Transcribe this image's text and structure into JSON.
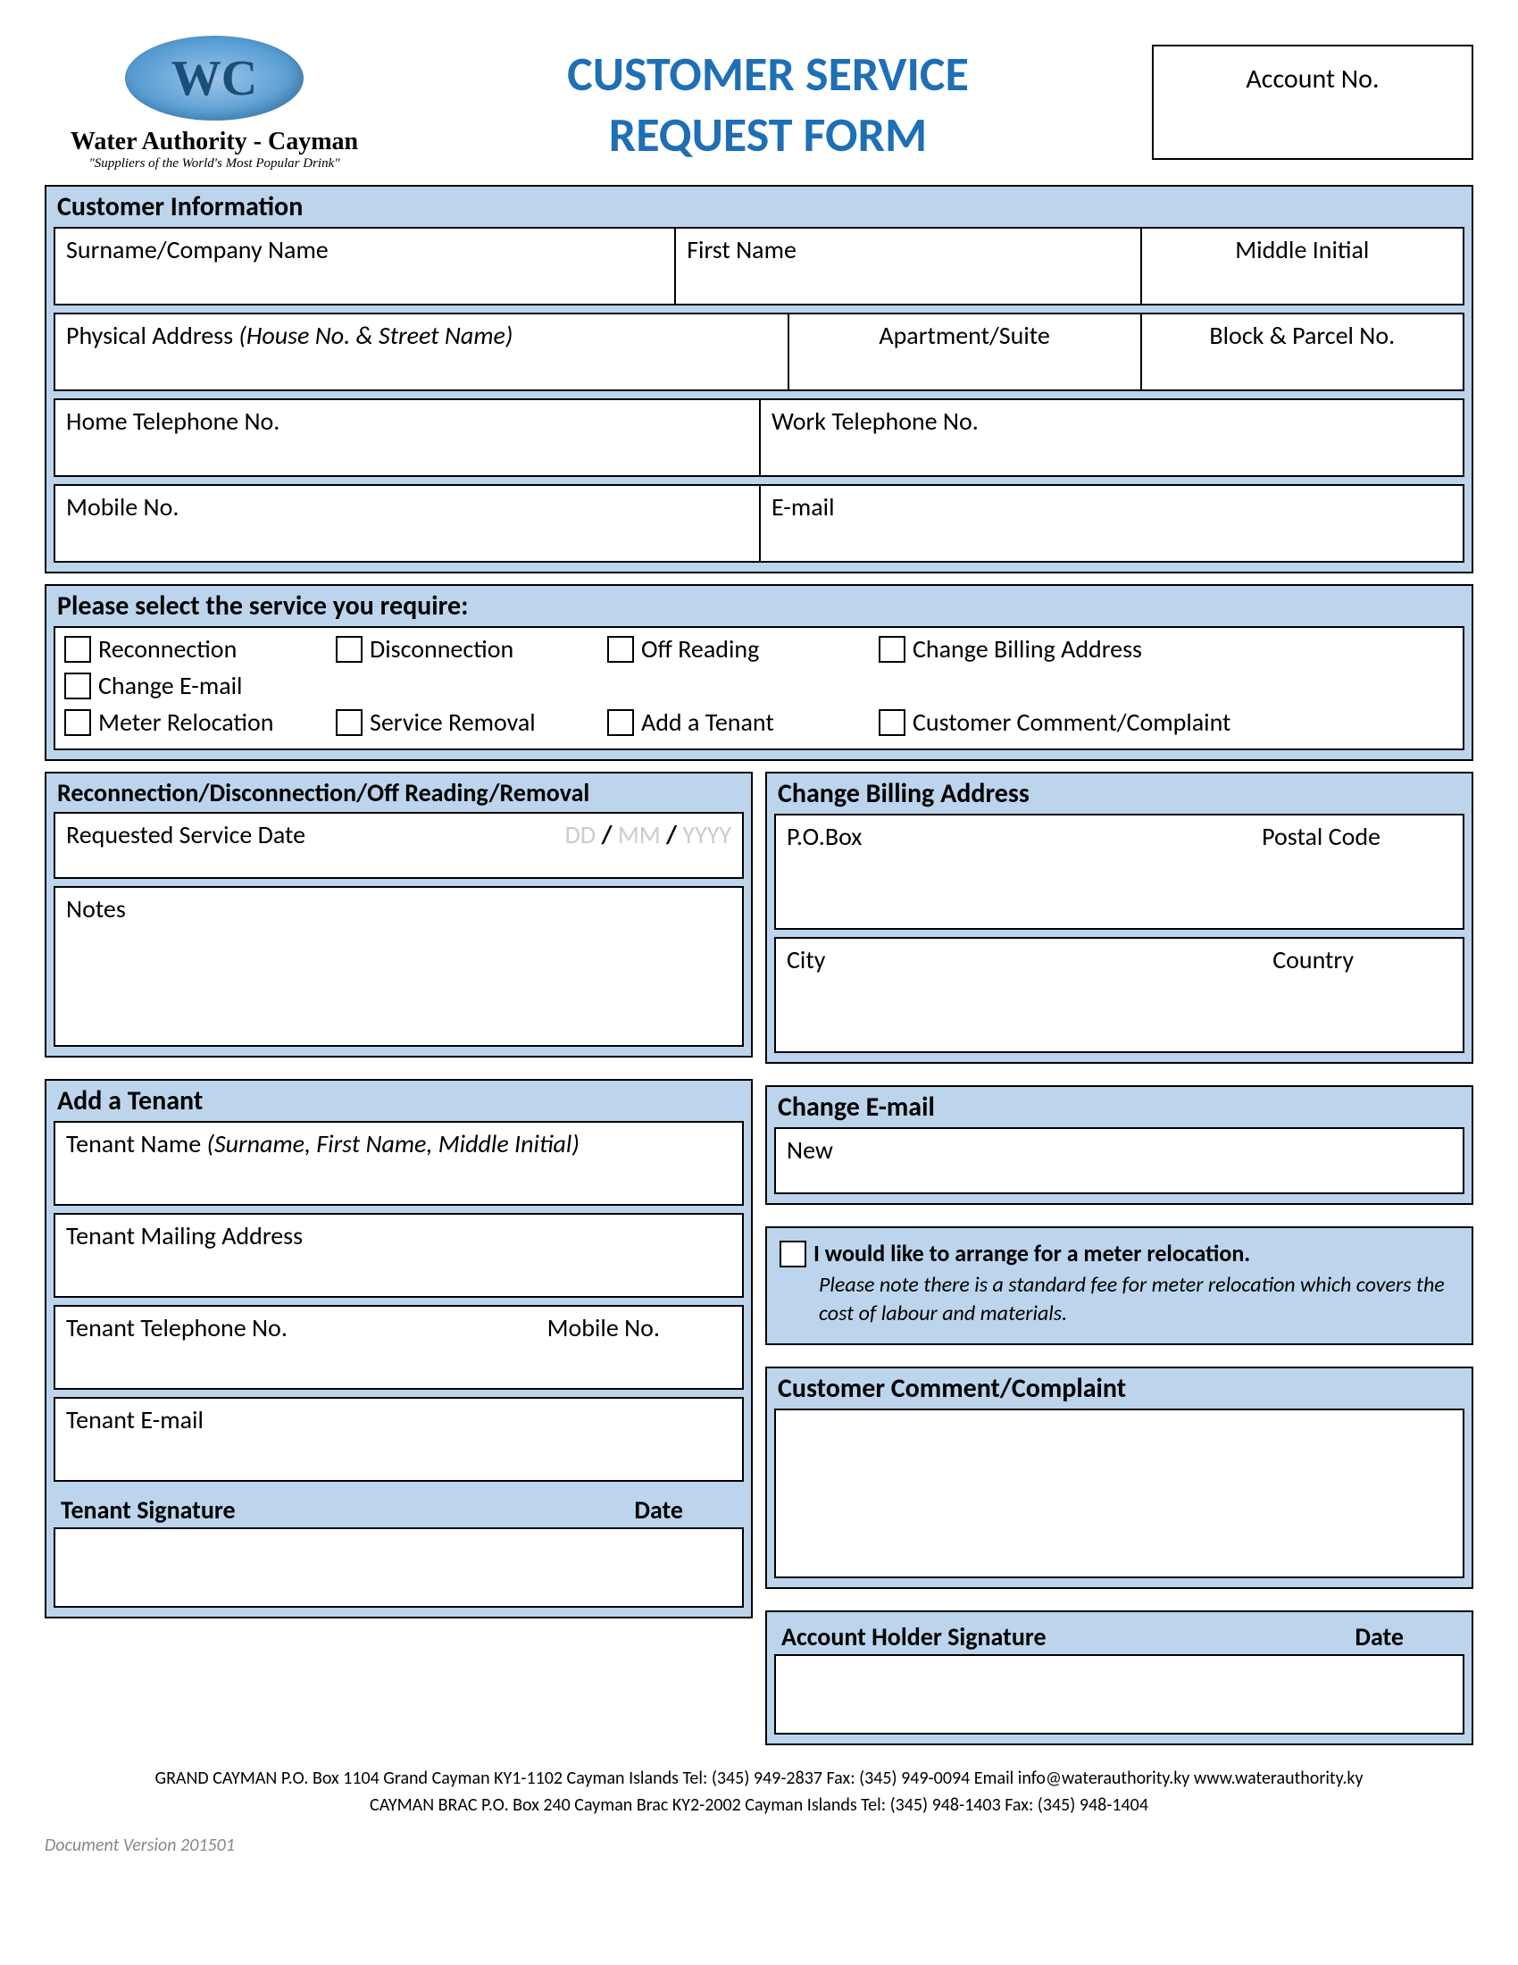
{
  "logo": {
    "monogram": "WC",
    "name": "Water Authority - Cayman",
    "tagline": "\"Suppliers of the World's Most Popular Drink\""
  },
  "title_line1": "CUSTOMER SERVICE",
  "title_line2": "REQUEST FORM",
  "account_box_label": "Account No.",
  "customer_info": {
    "heading": "Customer Information",
    "surname": "Surname/Company Name",
    "first_name": "First Name",
    "middle_initial": "Middle Initial",
    "address_label": "Physical Address ",
    "address_hint": "(House No. & Street Name)",
    "apt": "Apartment/Suite",
    "block": "Block & Parcel No.",
    "home_tel": "Home Telephone No.",
    "work_tel": "Work Telephone No.",
    "mobile": "Mobile No.",
    "email": "E-mail"
  },
  "service_select": {
    "heading": "Please select the service you require:",
    "options": {
      "reconnection": "Reconnection",
      "disconnection": "Disconnection",
      "off_reading": "Off Reading",
      "change_billing": "Change Billing Address",
      "change_email": "Change E-mail",
      "meter_relocation": "Meter Relocation",
      "service_removal": "Service Removal",
      "add_tenant": "Add a Tenant",
      "complaint": "Customer Comment/Complaint"
    }
  },
  "recon": {
    "heading": "Reconnection/Disconnection/Off Reading/Removal",
    "date_label": "Requested Service Date",
    "date_dd": "DD",
    "date_sep": " / ",
    "date_mm": "MM",
    "date_yyyy": "YYYY",
    "notes": "Notes"
  },
  "tenant": {
    "heading": "Add a Tenant",
    "name_label": "Tenant Name ",
    "name_hint": "(Surname, First Name, Middle Initial)",
    "mail": "Tenant Mailing Address",
    "tel": "Tenant Telephone No.",
    "mobile": "Mobile No.",
    "email": "Tenant E-mail",
    "sig": "Tenant Signature",
    "sig_date": "Date"
  },
  "billing": {
    "heading": "Change Billing Address",
    "pobox": "P.O.Box",
    "postal": "Postal Code",
    "city": "City",
    "country": "Country"
  },
  "email_change": {
    "heading": "Change E-mail",
    "new": "New"
  },
  "relocation": {
    "check_label": "I would like to arrange for a meter relocation.",
    "note": "Please note there is a standard fee for meter relocation which covers the cost of labour and materials."
  },
  "complaint": {
    "heading": "Customer Comment/Complaint"
  },
  "holder": {
    "sig": "Account Holder Signature",
    "sig_date": "Date"
  },
  "footer": {
    "line1": "GRAND CAYMAN P.O. Box 1104 Grand Cayman KY1-1102 Cayman Islands Tel: (345) 949-2837 Fax: (345) 949-0094 Email info@waterauthority.ky www.waterauthority.ky",
    "line2": "CAYMAN BRAC P.O. Box 240 Cayman Brac KY2-2002 Cayman Islands Tel: (345) 948-1403 Fax: (345) 948-1404"
  },
  "doc_version": "Document Version 201501"
}
